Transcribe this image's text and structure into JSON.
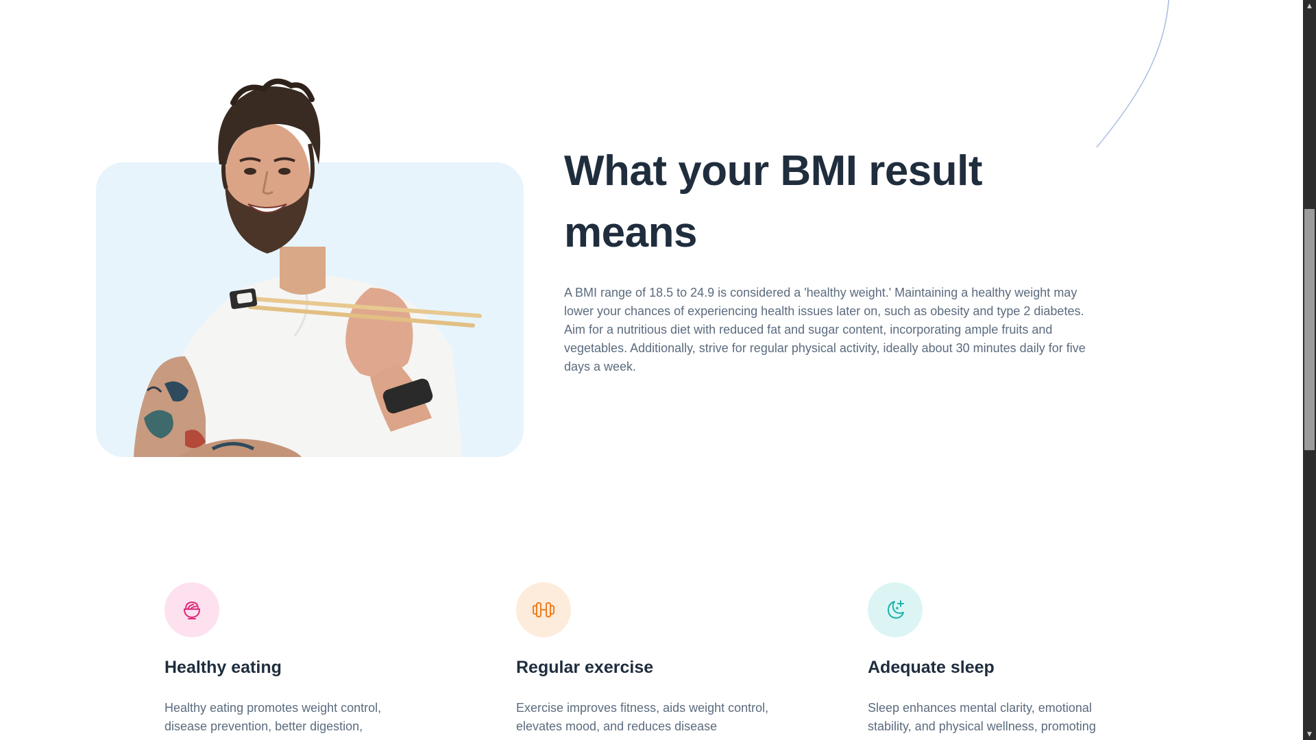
{
  "section": {
    "title": "What your BMI result means",
    "description": "A BMI range of 18.5 to 24.9 is considered a 'healthy weight.' Maintaining a healthy weight may lower your chances of experiencing health issues later on, such as obesity and type 2 diabetes. Aim for a nutritious diet with reduced fat and sugar content, incorporating ample fruits and vegetables. Additionally, strive for regular physical activity, ideally about 30 minutes daily for five days a week.",
    "image_subject": "smiling man holding chopsticks"
  },
  "features": [
    {
      "icon": "bowl-icon",
      "icon_color": "#e0297a",
      "icon_bg": "#fde1ee",
      "title": "Healthy eating",
      "text": "Healthy eating promotes weight control, disease prevention, better digestion,"
    },
    {
      "icon": "dumbbell-icon",
      "icon_color": "#ef7d1e",
      "icon_bg": "#fdebdc",
      "title": "Regular exercise",
      "text": "Exercise improves fitness, aids weight control, elevates mood, and reduces disease"
    },
    {
      "icon": "moon-stars-icon",
      "icon_color": "#1bb3ac",
      "icon_bg": "#dcf5f4",
      "title": "Adequate sleep",
      "text": "Sleep enhances mental clarity, emotional stability, and physical wellness, promoting"
    }
  ],
  "colors": {
    "heading": "#1f2d3d",
    "body_text": "#5b6b7e",
    "photo_bg": "#e7f4fc",
    "accent_arc": "#a8bde0"
  },
  "scrollbar": {
    "up_icon": "triangle-up-icon",
    "down_icon": "triangle-down-icon"
  }
}
